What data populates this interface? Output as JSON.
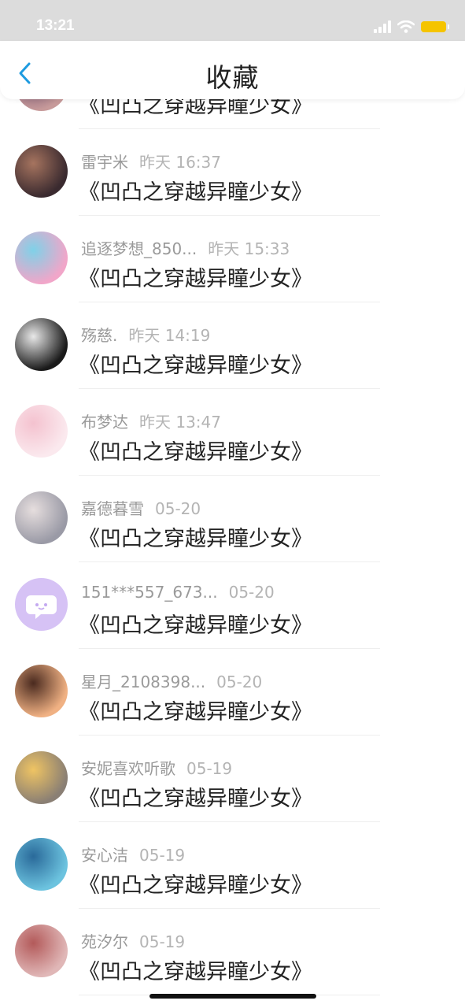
{
  "status_bar": {
    "time": "13:21"
  },
  "nav": {
    "title": "收藏"
  },
  "items": [
    {
      "user": "",
      "time": "",
      "title": "《凹凸之穿越异瞳少女》",
      "avatar": [
        "#c79a9a",
        "#6a4a6a"
      ]
    },
    {
      "user": "雷宇米",
      "time": "昨天 16:37",
      "title": "《凹凸之穿越异瞳少女》",
      "avatar": [
        "#3a2a2f",
        "#a6745f"
      ]
    },
    {
      "user": "追逐梦想_850...",
      "time": "昨天 15:33",
      "title": "《凹凸之穿越异瞳少女》",
      "avatar": [
        "#f1a6c9",
        "#7fd1e8"
      ]
    },
    {
      "user": "殇慈.",
      "time": "昨天 14:19",
      "title": "《凹凸之穿越异瞳少女》",
      "avatar": [
        "#1a1a1a",
        "#e8e8e8"
      ]
    },
    {
      "user": "布梦达",
      "time": "昨天 13:47",
      "title": "《凹凸之穿越异瞳少女》",
      "avatar": [
        "#fbe9ee",
        "#f4c2cf"
      ]
    },
    {
      "user": "嘉德暮雪",
      "time": "05-20",
      "title": "《凹凸之穿越异瞳少女》",
      "avatar": [
        "#9a9aa6",
        "#e6dede"
      ]
    },
    {
      "user": "151***557_673...",
      "time": "05-20",
      "title": "《凹凸之穿越异瞳少女》",
      "avatar": [
        "#d6c2f5",
        "#c4a9f0"
      ]
    },
    {
      "user": "星月_2108398...",
      "time": "05-20",
      "title": "《凹凸之穿越异瞳少女》",
      "avatar": [
        "#f0b183",
        "#4a2a1f"
      ]
    },
    {
      "user": "安妮喜欢听歌",
      "time": "05-19",
      "title": "《凹凸之穿越异瞳少女》",
      "avatar": [
        "#8a7f74",
        "#efc463"
      ]
    },
    {
      "user": "安心洁",
      "time": "05-19",
      "title": "《凹凸之穿越异瞳少女》",
      "avatar": [
        "#6cc3df",
        "#2a6a9a"
      ]
    },
    {
      "user": "苑汐尔",
      "time": "05-19",
      "title": "《凹凸之穿越异瞳少女》",
      "avatar": [
        "#e0b7b7",
        "#b35a5a"
      ]
    }
  ]
}
